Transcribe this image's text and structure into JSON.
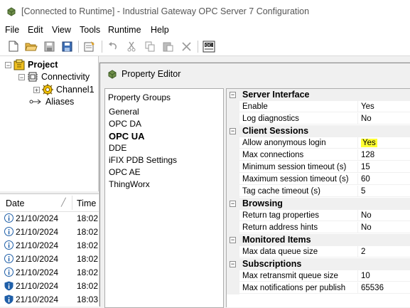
{
  "window": {
    "title": "[Connected to Runtime] - Industrial Gateway OPC Server 7 Configuration"
  },
  "menu": [
    "File",
    "Edit",
    "View",
    "Tools",
    "Runtime",
    "Help"
  ],
  "tree": {
    "project": "Project",
    "connectivity": "Connectivity",
    "channel": "Channel1",
    "aliases": "Aliases"
  },
  "log": {
    "headers": {
      "date": "Date",
      "time": "Time"
    },
    "rows": [
      {
        "date": "21/10/2024",
        "time": "18:02:",
        "icon": "info-icon"
      },
      {
        "date": "21/10/2024",
        "time": "18:02:",
        "icon": "info-icon"
      },
      {
        "date": "21/10/2024",
        "time": "18:02:",
        "icon": "info-icon"
      },
      {
        "date": "21/10/2024",
        "time": "18:02:",
        "icon": "info-icon"
      },
      {
        "date": "21/10/2024",
        "time": "18:02:",
        "icon": "info-icon"
      },
      {
        "date": "21/10/2024",
        "time": "18:02:",
        "icon": "shield-info-icon"
      },
      {
        "date": "21/10/2024",
        "time": "18:03:",
        "icon": "shield-info-icon"
      }
    ]
  },
  "dialog": {
    "title": "Property Editor",
    "groups_label": "Property Groups",
    "groups": [
      "General",
      "OPC DA",
      "OPC UA",
      "DDE",
      "iFIX PDB Settings",
      "OPC AE",
      "ThingWorx"
    ],
    "selected_group": "OPC UA"
  },
  "grid": {
    "sections": [
      {
        "name": "Server Interface",
        "props": [
          {
            "name": "Enable",
            "value": "Yes"
          },
          {
            "name": "Log diagnostics",
            "value": "No"
          }
        ]
      },
      {
        "name": "Client Sessions",
        "props": [
          {
            "name": "Allow anonymous login",
            "value": "Yes",
            "highlight": true
          },
          {
            "name": "Max connections",
            "value": "128"
          },
          {
            "name": "Minimum session timeout (s)",
            "value": "15"
          },
          {
            "name": "Maximum session timeout (s)",
            "value": "60"
          },
          {
            "name": "Tag cache timeout (s)",
            "value": "5"
          }
        ]
      },
      {
        "name": "Browsing",
        "props": [
          {
            "name": "Return tag properties",
            "value": "No"
          },
          {
            "name": "Return address hints",
            "value": "No"
          }
        ]
      },
      {
        "name": "Monitored Items",
        "props": [
          {
            "name": "Max data queue size",
            "value": "2"
          }
        ]
      },
      {
        "name": "Subscriptions",
        "props": [
          {
            "name": "Max retransmit queue size",
            "value": "10"
          },
          {
            "name": "Max notifications per publish",
            "value": "65536"
          }
        ]
      }
    ]
  },
  "colors": {
    "highlight": "#ffff33",
    "accent": "#0063b1"
  }
}
